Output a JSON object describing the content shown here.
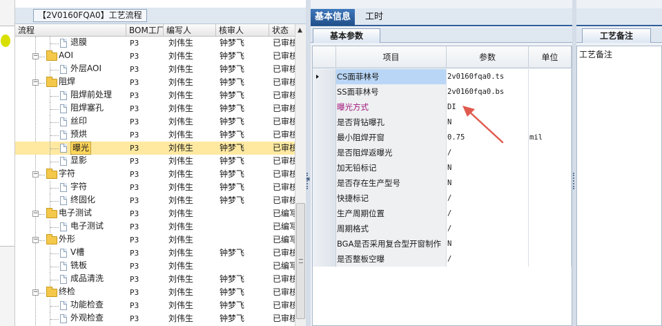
{
  "tree_panel": {
    "title": "【2V0160FQA0】工艺流程",
    "columns": [
      "流程",
      "BOM工厂",
      "编写人",
      "核审人",
      "状态"
    ],
    "rows": [
      {
        "name": "退膜",
        "level": 2,
        "type": "doc",
        "bom": "P3",
        "author": "刘伟生",
        "reviewer": "钟梦飞",
        "status": "已审核"
      },
      {
        "name": "AOI",
        "level": 1,
        "type": "folder",
        "bom": "P3",
        "author": "刘伟生",
        "reviewer": "钟梦飞",
        "status": "已审核"
      },
      {
        "name": "外层AOI",
        "level": 2,
        "type": "doc",
        "bom": "P3",
        "author": "刘伟生",
        "reviewer": "钟梦飞",
        "status": "已审核"
      },
      {
        "name": "阻焊",
        "level": 1,
        "type": "folder",
        "bom": "P3",
        "author": "刘伟生",
        "reviewer": "钟梦飞",
        "status": "已审核"
      },
      {
        "name": "阻焊前处理",
        "level": 2,
        "type": "doc",
        "bom": "P3",
        "author": "刘伟生",
        "reviewer": "钟梦飞",
        "status": "已审核"
      },
      {
        "name": "阻焊塞孔",
        "level": 2,
        "type": "doc",
        "bom": "P3",
        "author": "刘伟生",
        "reviewer": "钟梦飞",
        "status": "已审核"
      },
      {
        "name": "丝印",
        "level": 2,
        "type": "doc",
        "bom": "P3",
        "author": "刘伟生",
        "reviewer": "钟梦飞",
        "status": "已审核"
      },
      {
        "name": "预烘",
        "level": 2,
        "type": "doc",
        "bom": "P3",
        "author": "刘伟生",
        "reviewer": "钟梦飞",
        "status": "已审核"
      },
      {
        "name": "曝光",
        "level": 2,
        "type": "doc",
        "bom": "P3",
        "author": "刘伟生",
        "reviewer": "钟梦飞",
        "status": "已审核",
        "selected": true
      },
      {
        "name": "显影",
        "level": 2,
        "type": "doc",
        "bom": "P3",
        "author": "刘伟生",
        "reviewer": "钟梦飞",
        "status": "已审核"
      },
      {
        "name": "字符",
        "level": 1,
        "type": "folder",
        "bom": "P3",
        "author": "刘伟生",
        "reviewer": "钟梦飞",
        "status": "已审核"
      },
      {
        "name": "字符",
        "level": 2,
        "type": "doc",
        "bom": "P3",
        "author": "刘伟生",
        "reviewer": "钟梦飞",
        "status": "已审核"
      },
      {
        "name": "终固化",
        "level": 2,
        "type": "doc",
        "bom": "P3",
        "author": "刘伟生",
        "reviewer": "钟梦飞",
        "status": "已审核"
      },
      {
        "name": "电子测试",
        "level": 1,
        "type": "folder",
        "bom": "P3",
        "author": "刘伟生",
        "reviewer": "",
        "status": "已编写"
      },
      {
        "name": "电子测试",
        "level": 2,
        "type": "doc",
        "bom": "P3",
        "author": "刘伟生",
        "reviewer": "",
        "status": "已编写"
      },
      {
        "name": "外形",
        "level": 1,
        "type": "folder",
        "bom": "P3",
        "author": "刘伟生",
        "reviewer": "",
        "status": "已编写"
      },
      {
        "name": "V槽",
        "level": 2,
        "type": "doc",
        "bom": "P3",
        "author": "刘伟生",
        "reviewer": "钟梦飞",
        "status": "已审核"
      },
      {
        "name": "铣板",
        "level": 2,
        "type": "doc",
        "bom": "P3",
        "author": "刘伟生",
        "reviewer": "",
        "status": "已编写"
      },
      {
        "name": "成品清洗",
        "level": 2,
        "type": "doc",
        "bom": "P3",
        "author": "刘伟生",
        "reviewer": "钟梦飞",
        "status": "已审核"
      },
      {
        "name": "终检",
        "level": 1,
        "type": "folder",
        "bom": "P3",
        "author": "刘伟生",
        "reviewer": "钟梦飞",
        "status": "已审核"
      },
      {
        "name": "功能检查",
        "level": 2,
        "type": "doc",
        "bom": "P3",
        "author": "刘伟生",
        "reviewer": "钟梦飞",
        "status": "已审核"
      },
      {
        "name": "外观检查",
        "level": 2,
        "type": "doc",
        "bom": "P3",
        "author": "刘伟生",
        "reviewer": "钟梦飞",
        "status": "已审核"
      }
    ]
  },
  "top_tabs": [
    {
      "label": "基本信息",
      "active": true
    },
    {
      "label": "工时",
      "active": false
    }
  ],
  "sub_tab": "基本参数",
  "grid": {
    "headers": {
      "item": "项目",
      "param": "参数",
      "unit": "单位"
    },
    "rows": [
      {
        "item": "CS面菲林号",
        "param": "2v0160fqa0.ts",
        "unit": "",
        "current": true
      },
      {
        "item": "SS面菲林号",
        "param": "2v0160fqa0.bs",
        "unit": ""
      },
      {
        "item": "曝光方式",
        "param": "DI",
        "unit": "",
        "magenta": true
      },
      {
        "item": "是否背钻曝孔",
        "param": "N",
        "unit": ""
      },
      {
        "item": "最小阻焊开窗",
        "param": "0.75",
        "unit": "mil"
      },
      {
        "item": "是否阻焊返曝光",
        "param": "/",
        "unit": ""
      },
      {
        "item": "加无铅标记",
        "param": "N",
        "unit": ""
      },
      {
        "item": "是否存在生产型号",
        "param": "N",
        "unit": ""
      },
      {
        "item": "快捷标记",
        "param": "/",
        "unit": ""
      },
      {
        "item": "生产周期位置",
        "param": "/",
        "unit": ""
      },
      {
        "item": "周期格式",
        "param": "/",
        "unit": ""
      },
      {
        "item": "BGA是否采用复合型开窗制作",
        "param": "N",
        "unit": ""
      },
      {
        "item": "是否整板空曝",
        "param": "/",
        "unit": ""
      }
    ]
  },
  "notes": {
    "tab_label": "工艺备注",
    "field_label": "工艺备注"
  },
  "colors": {
    "selection": "#ffd65a",
    "accent_tab": "#2f5f99",
    "annotation_arrow": "#e05a4e",
    "magenta_label": "#a0147a"
  },
  "icons": {
    "folder": "folder-icon",
    "document": "document-icon",
    "row_pointer": "row-pointer-icon",
    "annotation": "red-arrow-icon"
  }
}
